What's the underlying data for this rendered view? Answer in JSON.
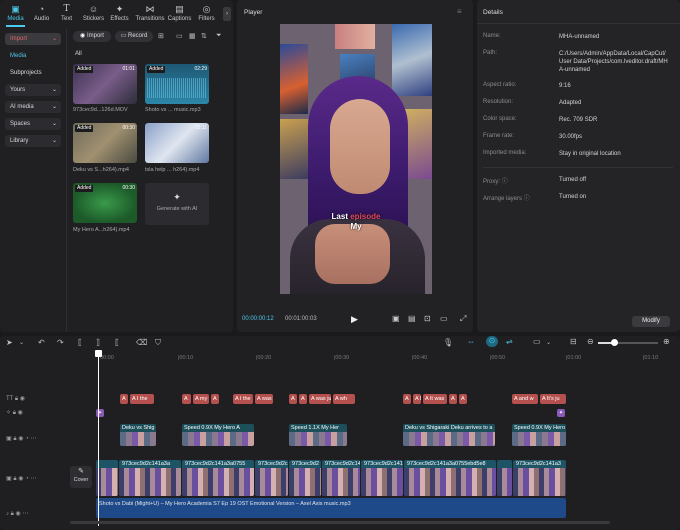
{
  "toolbar": {
    "items": [
      {
        "label": "Media",
        "icon": "media-icon"
      },
      {
        "label": "Audio",
        "icon": "audio-icon"
      },
      {
        "label": "Text",
        "icon": "text-icon"
      },
      {
        "label": "Stickers",
        "icon": "stickers-icon"
      },
      {
        "label": "Effects",
        "icon": "effects-icon"
      },
      {
        "label": "Transitions",
        "icon": "transitions-icon"
      },
      {
        "label": "Captions",
        "icon": "captions-icon"
      },
      {
        "label": "Filters",
        "icon": "filters-icon"
      }
    ]
  },
  "sidebar": {
    "items": [
      {
        "label": "Import",
        "chev": "⌄"
      },
      {
        "label": "Media",
        "chev": ""
      },
      {
        "label": "Subprojects",
        "chev": ""
      },
      {
        "label": "Yours",
        "chev": "⌄"
      },
      {
        "label": "AI media",
        "chev": "⌄"
      },
      {
        "label": "Spaces",
        "chev": "⌄"
      },
      {
        "label": "Library",
        "chev": "⌄"
      }
    ]
  },
  "media": {
    "import_label": "Import",
    "record_label": "Record",
    "filter_all": "All",
    "items": [
      {
        "name": "973cec9d...126d.MOV",
        "tag": "Added",
        "duration": "01:01"
      },
      {
        "name": "Shoto vs ... music.mp3",
        "tag": "Added",
        "duration": "02:29"
      },
      {
        "name": "Deku vs S...h264).mp4",
        "tag": "Added",
        "duration": "00:30"
      },
      {
        "name": "tsla help ... h264).mp4",
        "tag": "",
        "duration": "02:11"
      },
      {
        "name": "My Hero A...h264).mp4",
        "tag": "Added",
        "duration": "00:30"
      }
    ],
    "generate_ai": "Generate with AI"
  },
  "player": {
    "title": "Player",
    "caption_line1_a": "Last",
    "caption_line1_b": "episode",
    "caption_line2": "My",
    "time_current": "00:00:00:12",
    "time_total": "00:01:00:03"
  },
  "details": {
    "title": "Details",
    "rows": [
      {
        "label": "Name:",
        "value": "MHA-unnamed"
      },
      {
        "label": "Path:",
        "value": "C:/Users/Admin/AppData/Local/CapCut/User Data/Projects/com.lveditor.draft/MHA-unnamed"
      },
      {
        "label": "Aspect ratio:",
        "value": "9:16"
      },
      {
        "label": "Resolution:",
        "value": "Adapted"
      },
      {
        "label": "Color space:",
        "value": "Rec. 709 SDR"
      },
      {
        "label": "Frame rate:",
        "value": "30.00fps"
      },
      {
        "label": "Imported media:",
        "value": "Stay in original location"
      },
      {
        "label": "Proxy:",
        "value": "Turned off"
      },
      {
        "label": "Arrange layers",
        "value": "Turned on"
      }
    ],
    "modify_label": "Modify"
  },
  "timeline": {
    "ticks": [
      "00:00",
      "|00:10",
      "|00:20",
      "|00:30",
      "|00:40",
      "|00:50",
      "|01:00",
      "|01:10"
    ],
    "text_clips": [
      {
        "text": "A"
      },
      {
        "text": "A I the"
      },
      {
        "text": "A"
      },
      {
        "text": "A my"
      },
      {
        "text": "A"
      },
      {
        "text": "A I the"
      },
      {
        "text": "A was"
      },
      {
        "text": "A"
      },
      {
        "text": "A"
      },
      {
        "text": "A was jus"
      },
      {
        "text": "A wh"
      },
      {
        "text": "A"
      },
      {
        "text": "A I"
      },
      {
        "text": "A It was"
      },
      {
        "text": "A"
      },
      {
        "text": "A"
      },
      {
        "text": "A and w"
      },
      {
        "text": "A It's ju"
      }
    ],
    "overlay_clips": [
      {
        "title": "Deku vs Shig"
      },
      {
        "title": "Speed 0.9X  My Hero A"
      },
      {
        "title": "Speed 1.1X  My Her"
      },
      {
        "title": "Deku vs Shigaraki  Deku arrives to a"
      },
      {
        "title": "Speed 0.9X  My Hero"
      }
    ],
    "main_clips": [
      {
        "title": "973cec9d2c141a3a"
      },
      {
        "title": "973cec9d2c141a3a0755"
      },
      {
        "title": "973cec9d2c141a3a0755"
      },
      {
        "title": "973cec9d2"
      },
      {
        "title": "973cec9d2c141a3a0755"
      },
      {
        "title": "973cec9d2c141"
      },
      {
        "title": "973cec9d2c141a3a0755ebd5e8"
      },
      {
        "title": "973cec9d2c141a3"
      }
    ],
    "cover_label": "Cover",
    "audio_title": "Shoto vs Dabi (Might+U) – My Hero Academia S7 Ep 19 OST  Emotional Version – Axel Axis music.mp3"
  }
}
